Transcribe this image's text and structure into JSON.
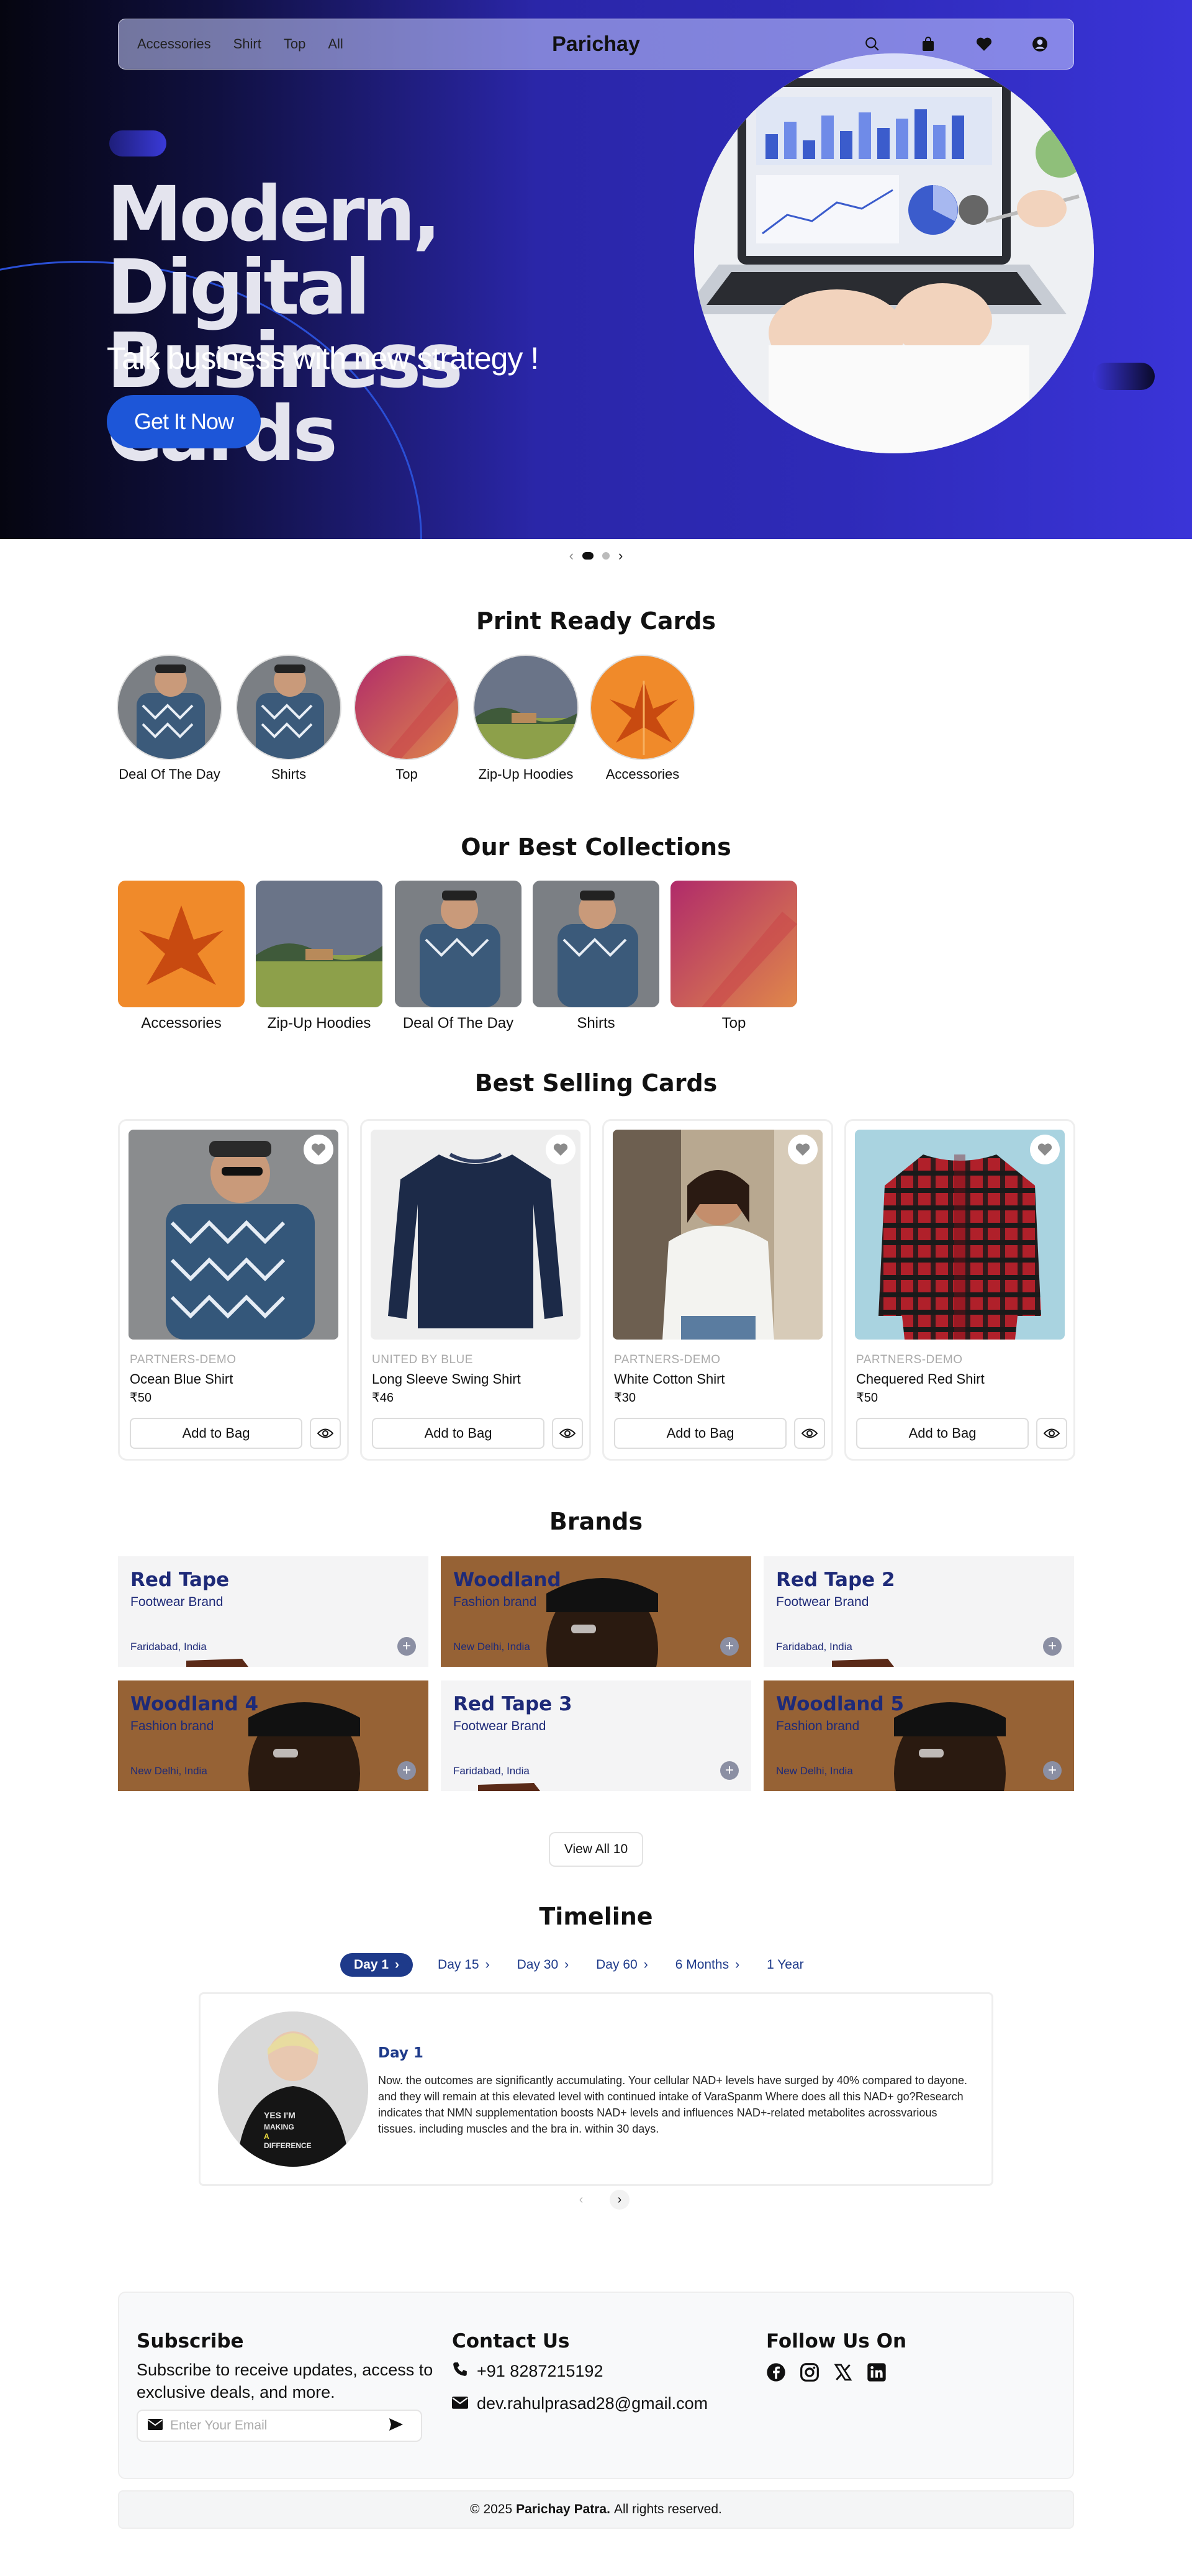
{
  "nav": {
    "links": [
      "Accessories",
      "Shirt",
      "Top",
      "All"
    ],
    "brand": "Parichay",
    "icons": [
      "search-icon",
      "bag-icon",
      "heart-icon",
      "user-icon"
    ]
  },
  "hero": {
    "title_line1": "Modern, Digital",
    "title_line2": "Business Cards",
    "subtitle": "Talk business with new strategy !",
    "cta": "Get It Now"
  },
  "carousel": {
    "slides": 2,
    "active": 1
  },
  "print_ready": {
    "title": "Print Ready Cards",
    "items": [
      "Deal Of The Day",
      "Shirts",
      "Top",
      "Zip-Up Hoodies",
      "Accessories"
    ]
  },
  "collections": {
    "title": "Our Best Collections",
    "items": [
      "Accessories",
      "Zip-Up Hoodies",
      "Deal Of The Day",
      "Shirts",
      "Top"
    ]
  },
  "best_selling": {
    "title": "Best Selling Cards",
    "add_label": "Add to Bag",
    "products": [
      {
        "vendor": "PARTNERS-DEMO",
        "name": "Ocean Blue Shirt",
        "price": "₹50"
      },
      {
        "vendor": "UNITED BY BLUE",
        "name": "Long Sleeve Swing Shirt",
        "price": "₹46"
      },
      {
        "vendor": "PARTNERS-DEMO",
        "name": "White Cotton Shirt",
        "price": "₹30"
      },
      {
        "vendor": "PARTNERS-DEMO",
        "name": "Chequered Red Shirt",
        "price": "₹50"
      }
    ]
  },
  "brands": {
    "title": "Brands",
    "items": [
      {
        "name": "Red Tape",
        "type": "Footwear Brand",
        "location": "Faridabad, India"
      },
      {
        "name": "Woodland",
        "type": "Fashion brand",
        "location": "New Delhi, India"
      },
      {
        "name": "Red Tape 2",
        "type": "Footwear Brand",
        "location": "Faridabad, India"
      },
      {
        "name": "Woodland 4",
        "type": "Fashion brand",
        "location": "New Delhi, India"
      },
      {
        "name": "Red Tape 3",
        "type": "Footwear Brand",
        "location": "Faridabad, India"
      },
      {
        "name": "Woodland 5",
        "type": "Fashion brand",
        "location": "New Delhi, India"
      }
    ],
    "plus": "+",
    "view_all": "View All 10"
  },
  "timeline": {
    "title": "Timeline",
    "tabs": [
      "Day 1",
      "Day 15",
      "Day 30",
      "Day 60",
      "6 Months",
      "1 Year"
    ],
    "active_tab": "Day 1",
    "card_title": "Day 1",
    "card_body": "Now. the outcomes are significantly accumulating. Your cellular NAD+ levels have surged by 40% compared to dayone. and they will remain at this elevated level with continued intake of VaraSpanm Where does all this NAD+ go?Research indicates that NMN supplementation boosts NAD+ levels and influences NAD+-related metabolites acrossvarious tissues. including muscles and the bra in. within 30 days.",
    "avatar_text": [
      "YES I'M",
      "MAKING",
      "A",
      "DIFFERENCE"
    ]
  },
  "footer": {
    "subscribe_title": "Subscribe",
    "subscribe_text": "Subscribe to receive updates, access to exclusive deals, and more.",
    "email_placeholder": "Enter Your Email",
    "contact_title": "Contact Us",
    "phone": "+91 8287215192",
    "email": "dev.rahulprasad28@gmail.com",
    "follow_title": "Follow Us On",
    "social": [
      "facebook-icon",
      "instagram-icon",
      "x-icon",
      "linkedin-icon"
    ],
    "copyright_prefix": "© 2025",
    "copyright_name": "Parichay Patra.",
    "copyright_suffix": "All rights reserved."
  },
  "colors": {
    "hero_accent": "#2e2ab8",
    "primary": "#1e3a8a",
    "cta": "#1d56d8",
    "brand_text": "#1e2a78"
  }
}
